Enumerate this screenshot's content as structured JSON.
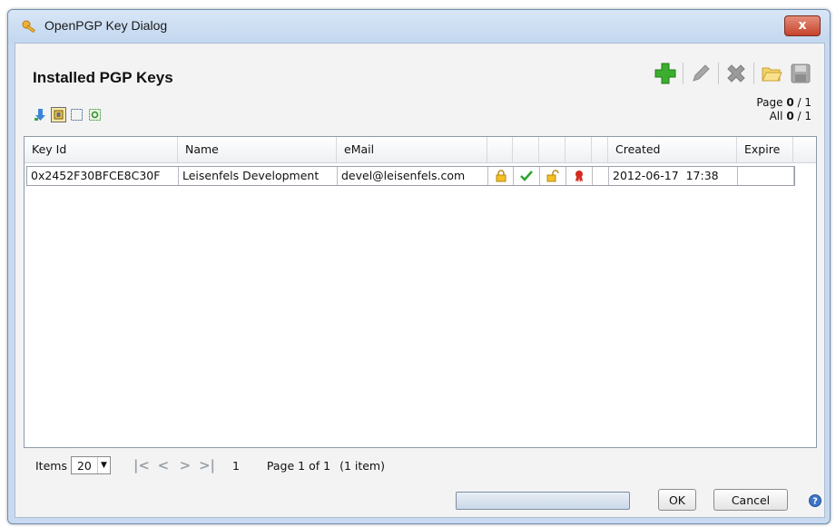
{
  "window": {
    "title": "OpenPGP Key Dialog",
    "close_label": "x"
  },
  "heading": "Installed PGP Keys",
  "toolbar": {
    "icons": [
      "add-icon",
      "edit-icon",
      "delete-icon",
      "open-folder-icon",
      "save-icon"
    ]
  },
  "small_tools": {
    "icons": [
      "import-arrow-icon",
      "select-all-icon",
      "select-none-icon",
      "refresh-icon"
    ]
  },
  "pageinfo": {
    "page_label": "Page",
    "page_current": "0",
    "page_total": "/ 1",
    "all_label": "All",
    "all_current": "0",
    "all_total": "/ 1"
  },
  "grid": {
    "columns": [
      "Key Id",
      "Name",
      "eMail",
      "",
      "",
      "",
      "",
      "",
      "Created",
      "Expire"
    ],
    "rows": [
      {
        "key_id": "0x2452F30BFCE8C30F",
        "name": "Leisenfels Development",
        "email": "devel@leisenfels.com",
        "icons": [
          "lock-icon",
          "check-icon",
          "unlock-icon",
          "certificate-icon"
        ],
        "created": "2012-06-17  17:38",
        "expire": ""
      }
    ]
  },
  "pager": {
    "items_label": "Items",
    "items_value": "20",
    "page_number": "1",
    "page_text": "Page 1 of 1",
    "count_text": "(1 item)"
  },
  "progress": {
    "fraction": 0
  },
  "buttons": {
    "ok": "OK",
    "cancel": "Cancel"
  },
  "colors": {
    "titlebar": "#c9daf0",
    "close": "#c7432c",
    "add": "#3cae2e"
  }
}
